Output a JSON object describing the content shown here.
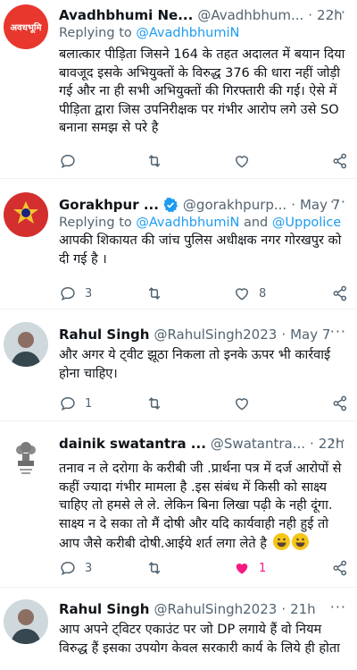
{
  "tweets": [
    {
      "name": "Avadhbhumi Ne...",
      "handle": "@Avadhbhum...",
      "sep": "·",
      "time": "22h",
      "reply_prefix": "Replying to ",
      "reply_to": "@AvadhbhumiN",
      "avatar_text": "अवधभूमि",
      "text": "बलात्कार पीड़िता जिसने 164 के तहत अदालत में बयान दिया बावजूद इसके अभियुक्तों के विरुद्ध 376 की धारा नहीं जोड़ी गई और ना ही सभी अभियुक्तों की गिरफ्तारी की गई। ऐसे में पीड़िता द्वारा जिस उपनिरीक्षक पर गंभीर आरोप लगे उसे SO बनाना समझ से परे है",
      "reply_count": "",
      "like_count": ""
    },
    {
      "name": "Gorakhpur ...",
      "handle": "@gorakhpurp...",
      "sep": "·",
      "time": "May 7",
      "reply_prefix": "Replying to ",
      "reply_to": "@AvadhbhumiN",
      "reply_and": " and ",
      "reply_to2": "@Uppolice",
      "text": "आपकी शिकायत की जांच पुलिस अधीक्षक नगर गोरखपुर को दी गई है ।",
      "reply_count": "3",
      "like_count": "8"
    },
    {
      "name": "Rahul Singh",
      "handle": "@RahulSingh2023",
      "sep": "·",
      "time": "May 7",
      "text": "और अगर ये ट्वीट झूठा निकला तो इनके ऊपर भी कार्रवाई होना चाहिए।",
      "reply_count": "1",
      "like_count": ""
    },
    {
      "name": "dainik swatantra ...",
      "handle": "@Swatantra...",
      "sep": "·",
      "time": "22h",
      "text": "तनाव न ले दरोगा के करीबी जी .प्रार्थना पत्र में दर्ज आरोपों से कहीं ज्यादा गंभीर मामला है .इस संबंध में किसी को साक्ष्य चाहिए तो हमसे ले ले. लेकिन बिना लिखा पढ़ी के नही दूंगा. साक्ष्य न दे सका तो मैं दोषी  और यदि कार्यवाही नही हुई तो आप जैसे करीबी दोषी.आईये शर्त लगा लेते है",
      "reply_count": "3",
      "like_count": "1"
    },
    {
      "name": "Rahul Singh",
      "handle": "@RahulSingh2023",
      "sep": "·",
      "time": "21h",
      "text": "आप अपने ट्विटर एकाउंट पर जो DP लगाये हैं वो नियम विरुद्ध हैं इसका उपयोग केवल सरकारी कार्य के लिये ही होता"
    }
  ],
  "colors": {
    "accent": "#1d9bf0",
    "muted": "#536471",
    "like": "#f91880"
  }
}
